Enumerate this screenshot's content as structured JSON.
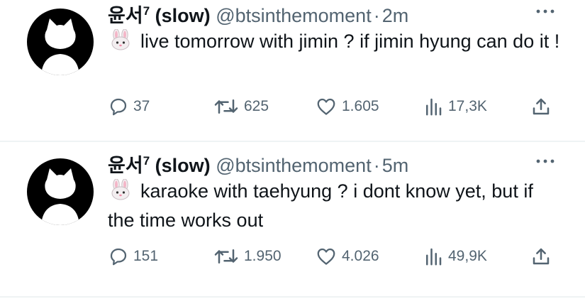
{
  "tweets": [
    {
      "display_name": "윤서",
      "superscript": "7",
      "name_suffix": "(slow)",
      "handle": "@btsinthemoment",
      "separator": "·",
      "time": "2m",
      "emoji_icon": "rabbit-face-icon",
      "text": "live tomorrow with jimin ? if jimin hyung can do it !",
      "replies": "37",
      "retweets": "625",
      "likes": "1.605",
      "views": "17,3K"
    },
    {
      "display_name": "윤서",
      "superscript": "7",
      "name_suffix": "(slow)",
      "handle": "@btsinthemoment",
      "separator": "·",
      "time": "5m",
      "emoji_icon": "rabbit-face-icon",
      "text": "karaoke with taehyung ? i dont know yet, but if the time works out",
      "replies": "151",
      "retweets": "1.950",
      "likes": "4.026",
      "views": "49,9K"
    }
  ],
  "colors": {
    "text": "#0f1419",
    "secondary": "#536471",
    "divider": "#eff3f4",
    "avatar_bg": "#000000"
  }
}
